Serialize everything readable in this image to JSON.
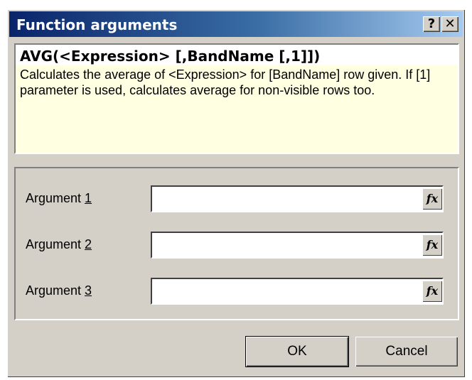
{
  "window": {
    "title": "Function arguments",
    "help_label": "?",
    "close_label": "✕"
  },
  "description": {
    "signature": "AVG(<Expression> [,BandName [,1]])",
    "text": "Calculates the average of <Expression> for [BandName] row given. If [1] parameter is used, calculates average for non-visible rows too."
  },
  "arguments": [
    {
      "label_prefix": "Argument ",
      "label_key": "1",
      "value": "",
      "fx_label": "fx"
    },
    {
      "label_prefix": "Argument ",
      "label_key": "2",
      "value": "",
      "fx_label": "fx"
    },
    {
      "label_prefix": "Argument ",
      "label_key": "3",
      "value": "",
      "fx_label": "fx"
    }
  ],
  "buttons": {
    "ok_label": "OK",
    "cancel_label": "Cancel"
  }
}
